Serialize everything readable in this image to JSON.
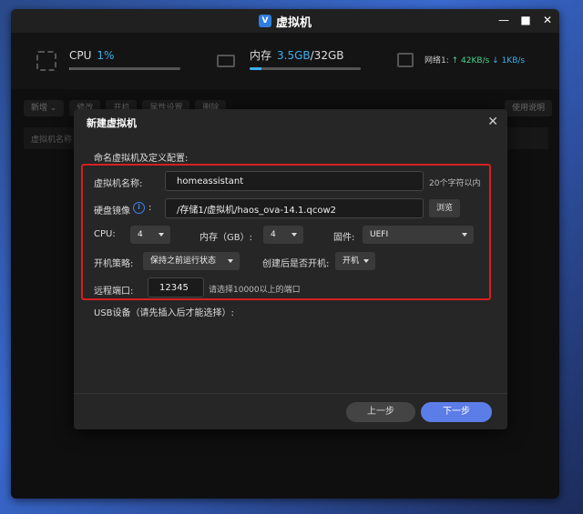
{
  "window": {
    "title": "虚拟机",
    "app_icon_letter": "V"
  },
  "stats": {
    "cpu": {
      "label": "CPU",
      "value": "1%",
      "progress": 1
    },
    "memory": {
      "label": "内存",
      "value": "3.5GB",
      "total": "/32GB",
      "progress": 11
    },
    "network": {
      "label": "网络1:",
      "up": "↑ 42KB/s",
      "down": "↓ 1KB/s"
    }
  },
  "background": {
    "toolbar": [
      "新增 ⌄",
      "修改",
      "开机",
      "属性设置",
      "删除"
    ],
    "help_label": "使用说明",
    "table_header": "虚拟机名称"
  },
  "modal": {
    "title": "新建虚拟机",
    "section_title": "命名虚拟机及定义配置:",
    "name_label": "虚拟机名称:",
    "name_value": "homeassistant",
    "name_hint": "20个字符以内",
    "disk_label": "硬盘镜像",
    "disk_colon": ":",
    "disk_value": "/存储1/虚拟机/haos_ova-14.1.qcow2",
    "browse_label": "浏览",
    "cpu_label": "CPU:",
    "cpu_value": "4",
    "memory_label": "内存（GB）:",
    "memory_value": "4",
    "firmware_label": "固件:",
    "firmware_value": "UEFI",
    "boot_policy_label": "开机策略:",
    "boot_policy_value": "保持之前运行状态",
    "start_after_label": "创建后是否开机:",
    "start_after_value": "开机",
    "port_label": "远程端口:",
    "port_value": "12345",
    "port_hint": "请选择10000以上的端口",
    "usb_title": "USB设备（请先插入后才能选择）:",
    "prev_label": "上一步",
    "next_label": "下一步"
  },
  "colors": {
    "accent": "#3bb0f0",
    "primary_button": "#5b7de8",
    "highlight_border": "#d62020"
  }
}
